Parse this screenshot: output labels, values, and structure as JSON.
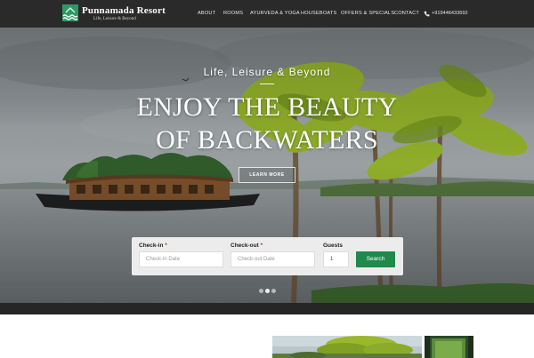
{
  "brand": {
    "name": "Punnamada Resort",
    "tagline": "Life, Leisure & Beyond"
  },
  "nav": {
    "items": [
      {
        "label": "ABOUT"
      },
      {
        "label": "ROOMS"
      },
      {
        "label": "AYURVEDA & YOGA"
      },
      {
        "label": "HOUSEBOATS"
      },
      {
        "label": "OFFERS & SPECIALS"
      },
      {
        "label": "CONTACT"
      }
    ],
    "phone": "+919446433692"
  },
  "hero": {
    "subtitle": "Life, Leisure & Beyond",
    "title_line1": "ENJOY THE BEAUTY",
    "title_line2": "OF BACKWATERS",
    "cta_label": "LEARN MORE",
    "slides": 3,
    "active_slide": 2
  },
  "booking": {
    "checkin_label": "Check-in",
    "checkin_placeholder": "Check-in Date",
    "checkout_label": "Check-out",
    "checkout_placeholder": "Check-out Date",
    "guests_label": "Guests",
    "guests_value": "1",
    "required_mark": "*",
    "search_label": "Search"
  },
  "colors": {
    "header_bg": "#2a2a2a",
    "accent_green": "#1f8a4c",
    "logo_green": "#2e9a63",
    "required_red": "#c0392b"
  },
  "icons": {
    "phone": "phone-icon",
    "logo": "logo-mark-icon"
  }
}
